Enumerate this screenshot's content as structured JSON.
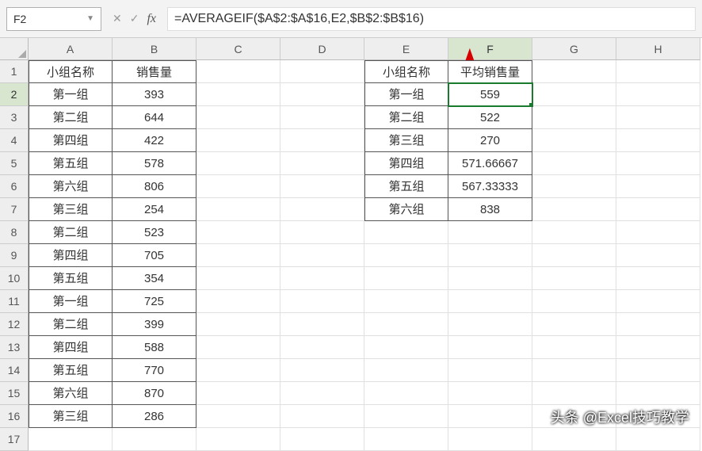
{
  "name_box": "F2",
  "formula": "=AVERAGEIF($A$2:$A$16,E2,$B$2:$B$16)",
  "columns": [
    "A",
    "B",
    "C",
    "D",
    "E",
    "F",
    "G",
    "H"
  ],
  "active_col_index": 5,
  "row_count": 17,
  "active_row_index": 1,
  "table1": {
    "header": [
      "小组名称",
      "销售量"
    ],
    "rows": [
      [
        "第一组",
        "393"
      ],
      [
        "第二组",
        "644"
      ],
      [
        "第四组",
        "422"
      ],
      [
        "第五组",
        "578"
      ],
      [
        "第六组",
        "806"
      ],
      [
        "第三组",
        "254"
      ],
      [
        "第二组",
        "523"
      ],
      [
        "第四组",
        "705"
      ],
      [
        "第五组",
        "354"
      ],
      [
        "第一组",
        "725"
      ],
      [
        "第二组",
        "399"
      ],
      [
        "第四组",
        "588"
      ],
      [
        "第五组",
        "770"
      ],
      [
        "第六组",
        "870"
      ],
      [
        "第三组",
        "286"
      ]
    ]
  },
  "table2": {
    "header": [
      "小组名称",
      "平均销售量"
    ],
    "rows": [
      [
        "第一组",
        "559"
      ],
      [
        "第二组",
        "522"
      ],
      [
        "第三组",
        "270"
      ],
      [
        "第四组",
        "571.66667"
      ],
      [
        "第五组",
        "567.33333"
      ],
      [
        "第六组",
        "838"
      ]
    ]
  },
  "watermark": "头条 @Excel技巧教学",
  "chart_data": null
}
